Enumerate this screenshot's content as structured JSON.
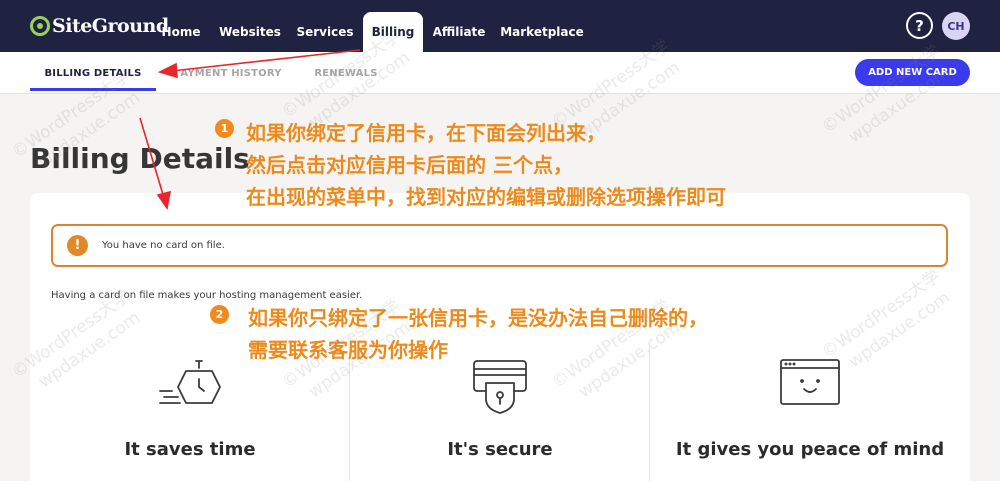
{
  "brand": {
    "name": "SiteGround",
    "accent": "#9ad05a",
    "nav_bg": "#1f2240",
    "primary": "#3b3aed"
  },
  "nav": {
    "tabs": [
      {
        "label": "Home"
      },
      {
        "label": "Websites"
      },
      {
        "label": "Services"
      },
      {
        "label": "Billing",
        "active": true
      },
      {
        "label": "Affiliate"
      },
      {
        "label": "Marketplace"
      }
    ],
    "help_icon": "question-circle-icon",
    "help_label": "?",
    "avatar_initials": "CH"
  },
  "subnav": {
    "tabs": [
      {
        "label": "BILLING DETAILS",
        "active": true
      },
      {
        "label": "PAYMENT HISTORY",
        "visible_label": "AYMENT HISTORY"
      },
      {
        "label": "RENEWALS"
      }
    ],
    "add_card_label": "ADD NEW CARD"
  },
  "page": {
    "title": "Billing Details",
    "alert": {
      "icon": "exclamation-circle-icon",
      "text": "You have no card on file.",
      "color": "#d8862f"
    },
    "intro": "Having a card on file makes your hosting management easier.",
    "features": [
      {
        "icon": "stopwatch-icon",
        "title": "It saves time"
      },
      {
        "icon": "credit-card-shield-icon",
        "title": "It's secure"
      },
      {
        "icon": "browser-smiley-icon",
        "title": "It gives you peace of mind"
      }
    ]
  },
  "annotations": {
    "color": "#ec8a1c",
    "notes": [
      {
        "number": "1",
        "lines": [
          "如果你绑定了信用卡，在下面会列出来，",
          "然后点击对应信用卡后面的 三个点，",
          "在出现的菜单中，找到对应的编辑或删除选项操作即可"
        ]
      },
      {
        "number": "2",
        "lines": [
          "如果你只绑定了一张信用卡，是没办法自己删除的，",
          "需要联系客服为你操作"
        ]
      }
    ],
    "arrow_color": "#e8262d"
  },
  "watermarks": [
    "©WordPress大学",
    "wpdaxue.com"
  ]
}
